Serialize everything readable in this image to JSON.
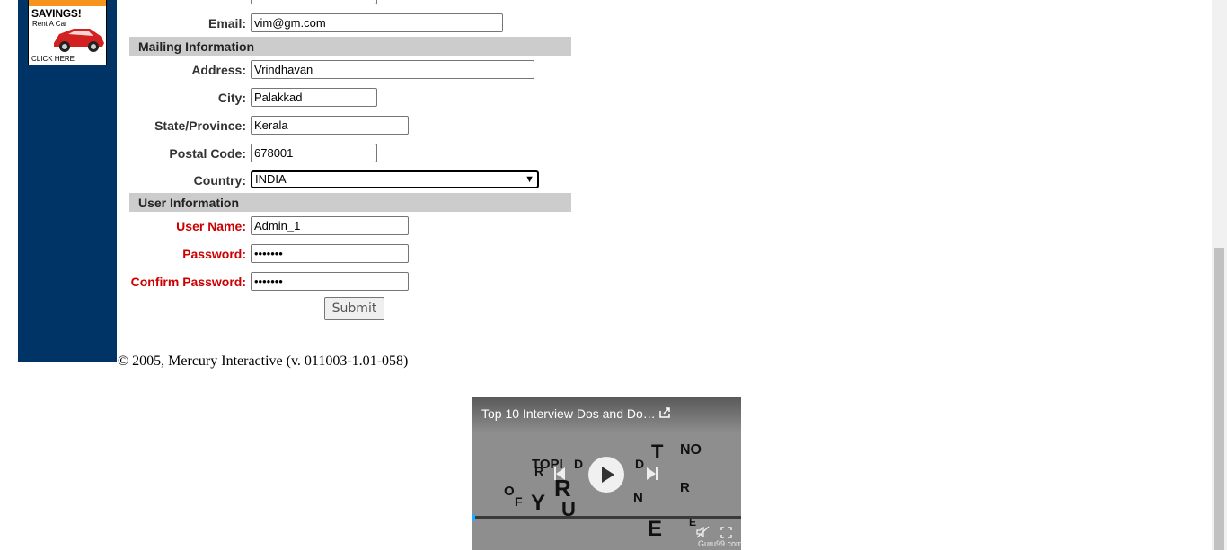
{
  "ad": {
    "title": "SAVINGS!",
    "subtitle": "Rent A Car",
    "cta": "CLICK HERE"
  },
  "form": {
    "email": {
      "label": "Email:",
      "value": "vim@gm.com"
    },
    "mailing_section": "Mailing Information",
    "address": {
      "label": "Address:",
      "value": "Vrindhavan"
    },
    "city": {
      "label": "City:",
      "value": "Palakkad"
    },
    "state": {
      "label": "State/Province:",
      "value": "Kerala"
    },
    "postal": {
      "label": "Postal Code:",
      "value": "678001"
    },
    "country": {
      "label": "Country:",
      "value": "INDIA"
    },
    "user_section": "User Information",
    "username": {
      "label": "User Name:",
      "value": "Admin_1"
    },
    "password": {
      "label": "Password:",
      "value": "•••••••"
    },
    "confirm": {
      "label": "Confirm Password:",
      "value": "•••••••"
    },
    "submit_label": "Submit"
  },
  "footer": "© 2005, Mercury Interactive (v. 011003-1.01-058)",
  "video": {
    "title": "Top 10 Interview Dos and Do…",
    "icons": [
      "share-icon",
      "previous-icon",
      "play-icon",
      "next-icon",
      "mute-icon",
      "fullscreen-icon"
    ],
    "watermark": "Guru99.com"
  },
  "colors": {
    "sidebar": "#003366",
    "section_bg": "#cccccc",
    "required_label": "#cc0000"
  }
}
